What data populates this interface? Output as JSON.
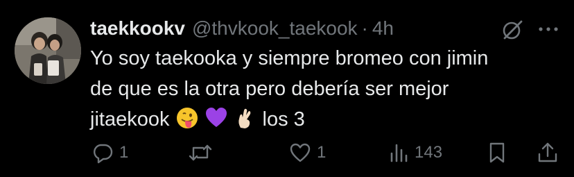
{
  "tweet": {
    "author": {
      "display_name": "taekkookv",
      "handle": "@thvkook_taekook",
      "separator": "·",
      "time": "4h"
    },
    "text": {
      "line1": "Yo soy taekooka y siempre bromeo con jimin",
      "line2": "de que es la otra pero debería ser mejor",
      "line3": "jitaekook",
      "line3_end": "los 3",
      "emojis": [
        "face-with-tongue-icon",
        "purple-heart-icon",
        "crossed-fingers-icon"
      ]
    },
    "actions": {
      "replies": "1",
      "reposts": "",
      "likes": "1",
      "views": "143"
    }
  },
  "colors": {
    "background": "#000000",
    "primary_text": "#e7e9ea",
    "secondary_text": "#71767b"
  }
}
